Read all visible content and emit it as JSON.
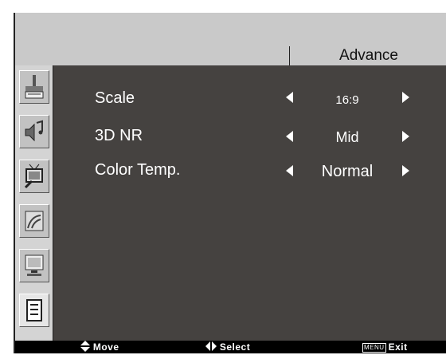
{
  "osd": {
    "title": "Advance",
    "rows": [
      {
        "label": "Scale",
        "value": "16:9"
      },
      {
        "label": "3D NR",
        "value": "Mid"
      },
      {
        "label": "Color Temp.",
        "value": "Normal"
      }
    ],
    "sidebar_icons": [
      "picture-icon",
      "sound-icon",
      "tv-icon",
      "pc-icon",
      "monitor-icon",
      "advance-icon"
    ]
  },
  "hints": {
    "move": "Move",
    "select": "Select",
    "menu_key": "MENU",
    "exit": "Exit"
  }
}
